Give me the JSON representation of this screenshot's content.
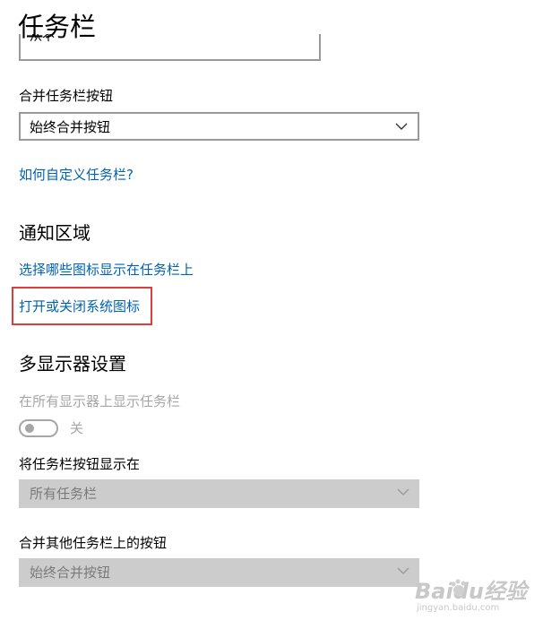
{
  "page": {
    "title": "任务栏"
  },
  "clipped_select": {
    "value": "从不"
  },
  "combine_buttons": {
    "label": "合并任务栏按钮",
    "value": "始终合并按钮"
  },
  "customize_link": "如何自定义任务栏?",
  "notification_area": {
    "heading": "通知区域",
    "select_icons_link": "选择哪些图标显示在任务栏上",
    "system_icons_link": "打开或关闭系统图标"
  },
  "multi_display": {
    "heading": "多显示器设置",
    "show_all_label": "在所有显示器上显示任务栏",
    "toggle_state": "关",
    "show_buttons_label": "将任务栏按钮显示在",
    "show_buttons_value": "所有任务栏",
    "combine_other_label": "合并其他任务栏上的按钮",
    "combine_other_value": "始终合并按钮"
  },
  "watermark": {
    "brand": "Baidu经验",
    "url": "jingyan.baidu.com"
  },
  "colors": {
    "link": "#0063b1",
    "highlight": "#e03c3c",
    "disabled": "#cccccc"
  },
  "icons": {
    "dropdown": "chevron-down-icon",
    "watermark": "baidu-paw-icon"
  }
}
